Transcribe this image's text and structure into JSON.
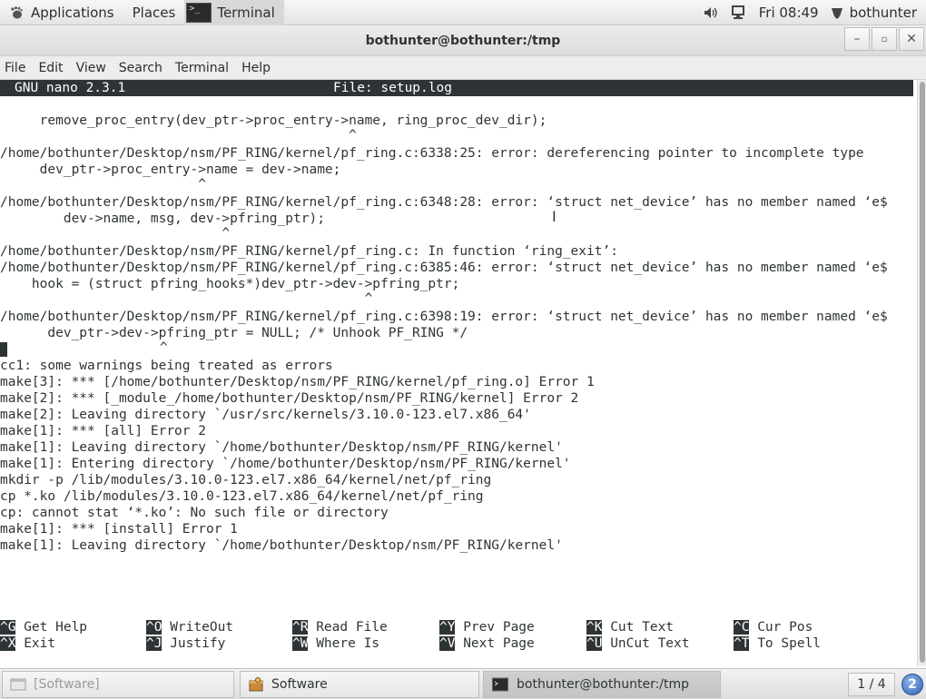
{
  "top_panel": {
    "applications": "Applications",
    "places": "Places",
    "terminal_task": "Terminal",
    "clock": "Fri 08:49",
    "user": "bothunter"
  },
  "window": {
    "title": "bothunter@bothunter:/tmp"
  },
  "menubar": [
    "File",
    "Edit",
    "View",
    "Search",
    "Terminal",
    "Help"
  ],
  "nano": {
    "version": "GNU nano 2.3.1",
    "file": "File: setup.log"
  },
  "terminal_lines": [
    "     remove_proc_entry(dev_ptr->proc_entry->name, ring_proc_dev_dir);",
    "                                            ^",
    "/home/bothunter/Desktop/nsm/PF_RING/kernel/pf_ring.c:6338:25: error: dereferencing pointer to incomplete type",
    "     dev_ptr->proc_entry->name = dev->name;",
    "                         ^",
    "/home/bothunter/Desktop/nsm/PF_RING/kernel/pf_ring.c:6348:28: error: ‘struct net_device’ has no member named ‘e$",
    "        dev->name, msg, dev->pfring_ptr);",
    "                            ^",
    "/home/bothunter/Desktop/nsm/PF_RING/kernel/pf_ring.c: In function ‘ring_exit’:",
    "/home/bothunter/Desktop/nsm/PF_RING/kernel/pf_ring.c:6385:46: error: ‘struct net_device’ has no member named ‘e$",
    "    hook = (struct pfring_hooks*)dev_ptr->dev->pfring_ptr;",
    "                                              ^",
    "/home/bothunter/Desktop/nsm/PF_RING/kernel/pf_ring.c:6398:19: error: ‘struct net_device’ has no member named ‘e$",
    "      dev_ptr->dev->pfring_ptr = NULL; /* Unhook PF_RING */",
    "                   ^",
    "cc1: some warnings being treated as errors",
    "make[3]: *** [/home/bothunter/Desktop/nsm/PF_RING/kernel/pf_ring.o] Error 1",
    "make[2]: *** [_module_/home/bothunter/Desktop/nsm/PF_RING/kernel] Error 2",
    "make[2]: Leaving directory `/usr/src/kernels/3.10.0-123.el7.x86_64'",
    "make[1]: *** [all] Error 2",
    "make[1]: Leaving directory `/home/bothunter/Desktop/nsm/PF_RING/kernel'",
    "make[1]: Entering directory `/home/bothunter/Desktop/nsm/PF_RING/kernel'",
    "mkdir -p /lib/modules/3.10.0-123.el7.x86_64/kernel/net/pf_ring",
    "cp *.ko /lib/modules/3.10.0-123.el7.x86_64/kernel/net/pf_ring",
    "cp: cannot stat ‘*.ko’: No such file or directory",
    "make[1]: *** [install] Error 1",
    "make[1]: Leaving directory `/home/bothunter/Desktop/nsm/PF_RING/kernel'"
  ],
  "shortcuts": [
    [
      {
        "key": "^G",
        "label": " Get Help"
      },
      {
        "key": "^O",
        "label": " WriteOut"
      },
      {
        "key": "^R",
        "label": " Read File"
      },
      {
        "key": "^Y",
        "label": " Prev Page"
      },
      {
        "key": "^K",
        "label": " Cut Text"
      },
      {
        "key": "^C",
        "label": " Cur Pos"
      }
    ],
    [
      {
        "key": "^X",
        "label": " Exit"
      },
      {
        "key": "^J",
        "label": " Justify"
      },
      {
        "key": "^W",
        "label": " Where Is"
      },
      {
        "key": "^V",
        "label": " Next Page"
      },
      {
        "key": "^U",
        "label": " UnCut Text"
      },
      {
        "key": "^T",
        "label": " To Spell"
      }
    ]
  ],
  "taskbar": {
    "task1": "[Software]",
    "task2": "Software",
    "task3": "bothunter@bothunter:/tmp",
    "pager": "1 / 4",
    "help_badge": "2"
  }
}
